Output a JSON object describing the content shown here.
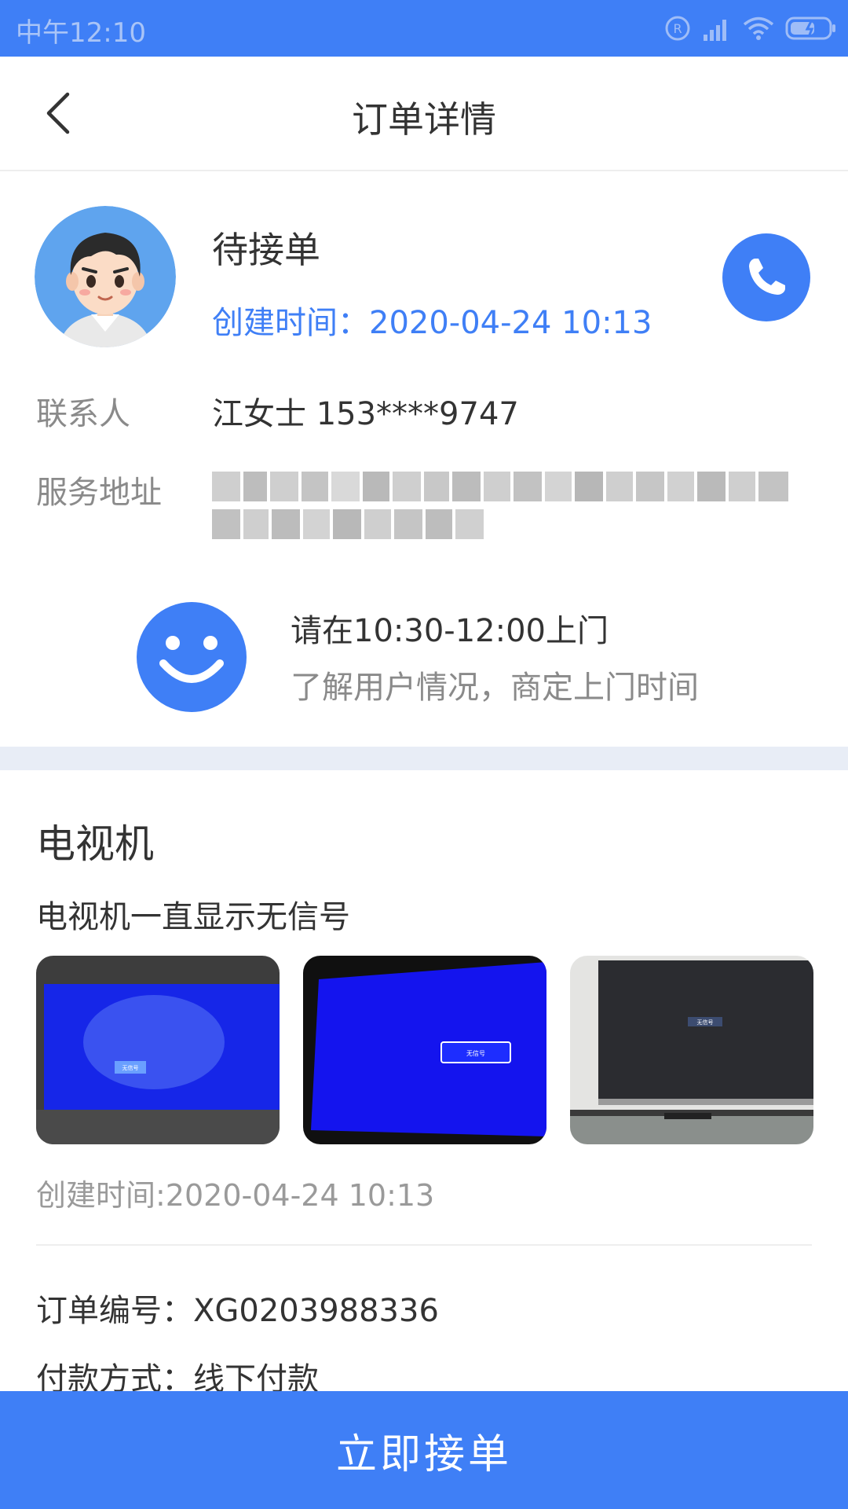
{
  "status_bar": {
    "time": "中午12:10"
  },
  "nav": {
    "title": "订单详情"
  },
  "order_status": {
    "status": "待接单",
    "created": "创建时间：2020-04-24 10:13"
  },
  "contact": {
    "label": "联系人",
    "value": "江女士   153****9747"
  },
  "address": {
    "label": "服务地址"
  },
  "visit": {
    "title": "请在10:30-12:00上门",
    "subtitle": "了解用户情况，商定上门时间"
  },
  "device": {
    "name": "电视机",
    "description": "电视机一直显示无信号",
    "photo_caption": "无信号",
    "created": "创建时间:2020-04-24 10:13"
  },
  "order_info": {
    "order_number": "订单编号：XG0203988336",
    "payment": "付款方式：线下付款"
  },
  "actions": {
    "accept_label": "立即接单"
  },
  "colors": {
    "accent": "#3f7ff6",
    "band": "#e8edf6",
    "muted_text": "#8a8a8a"
  }
}
